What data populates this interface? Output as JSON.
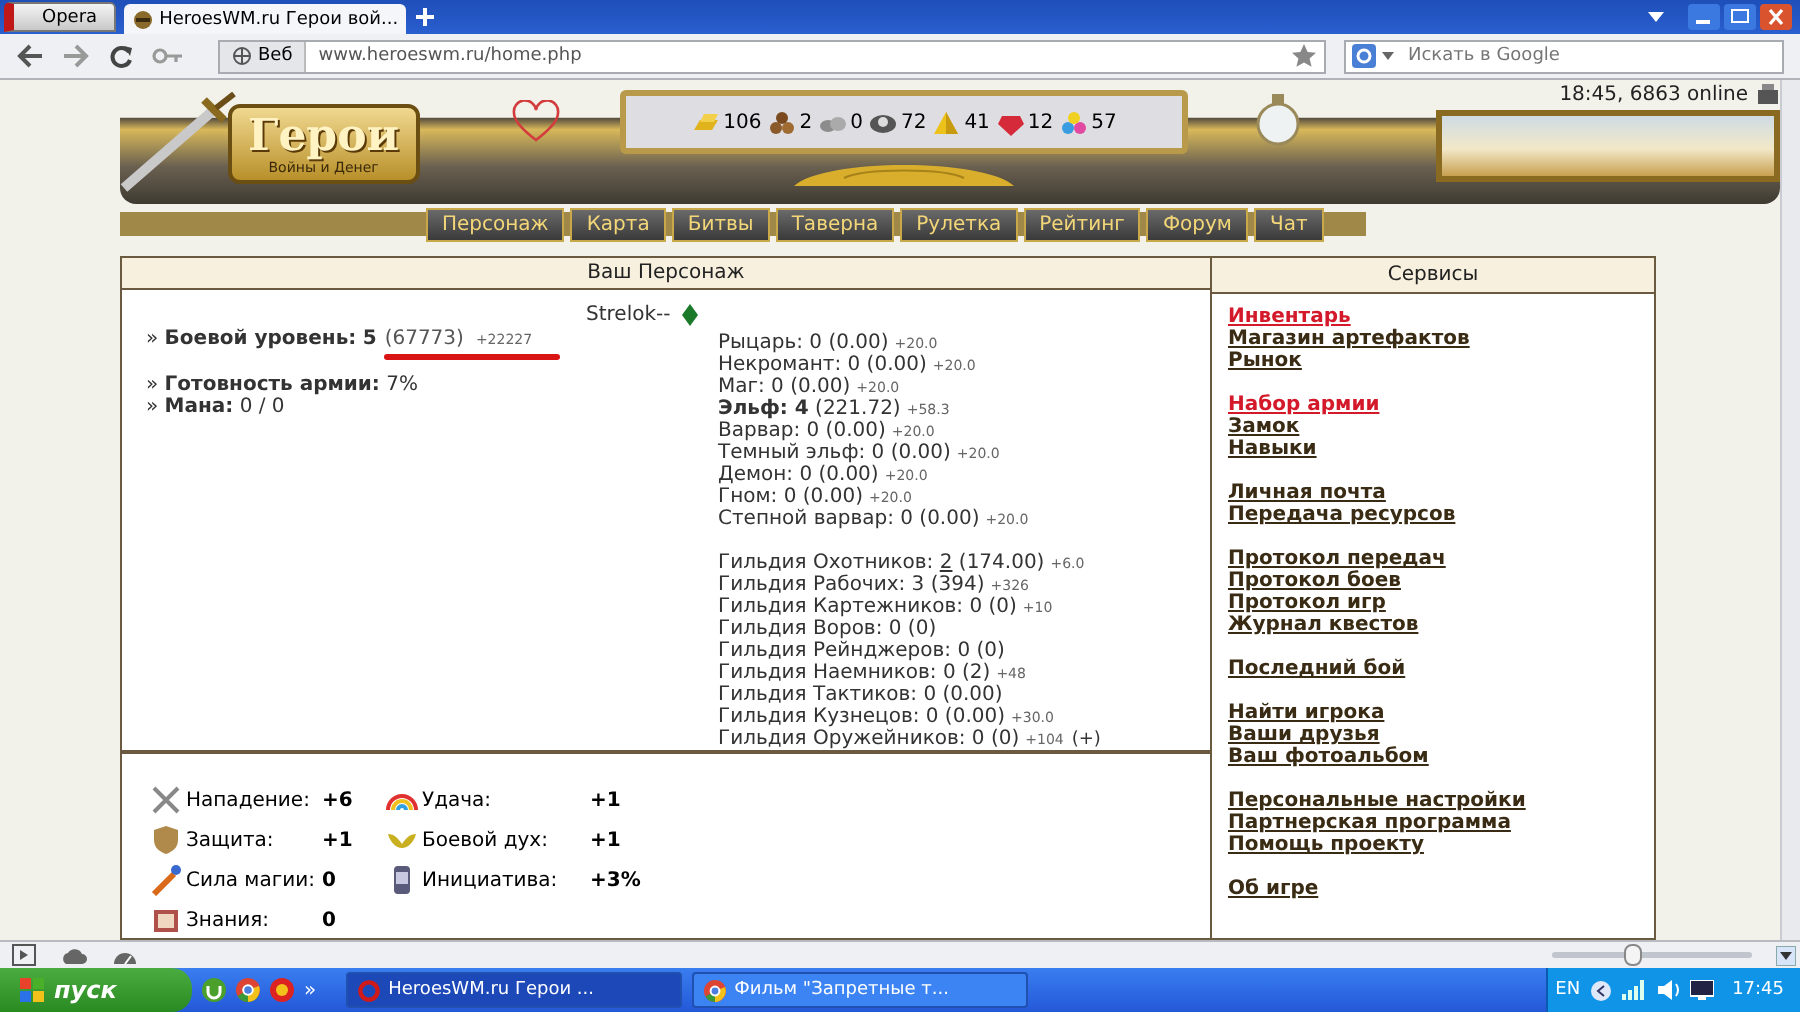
{
  "browser": {
    "menu_button": "Opera",
    "tabs": [
      {
        "title": "HeroesWM.ru Герои вой...",
        "selected": true
      }
    ],
    "address": {
      "badge": "Веб",
      "url": "www.heroeswm.ru/home.php"
    },
    "search": {
      "placeholder": "Искать в Google"
    }
  },
  "header": {
    "logo": {
      "title": "Герои",
      "subtitle": "Войны и Денег"
    },
    "resources": [
      {
        "kind": "gold",
        "value": "106"
      },
      {
        "kind": "wood",
        "value": "2"
      },
      {
        "kind": "ore",
        "value": "0"
      },
      {
        "kind": "mercury",
        "value": "72"
      },
      {
        "kind": "sulfur",
        "value": "41"
      },
      {
        "kind": "crystal",
        "value": "12"
      },
      {
        "kind": "gems",
        "value": "57"
      }
    ],
    "online": "18:45, 6863 online",
    "nav": [
      "Персонаж",
      "Карта",
      "Битвы",
      "Таверна",
      "Рулетка",
      "Рейтинг",
      "Форум",
      "Чат"
    ]
  },
  "character": {
    "title": "Ваш Персонаж",
    "name": "Strelok--",
    "stats": [
      {
        "bullet": "»",
        "label": "Боевой уровень:",
        "value": "5",
        "points": "(67773)",
        "bonus": "+22227",
        "highlighted": true
      },
      {
        "bullet": "»",
        "label": "Готовность армии:",
        "value": "7%",
        "highlighted": false
      },
      {
        "bullet": "»",
        "label": "Мана:",
        "value": "0 / 0",
        "highlighted": false
      }
    ],
    "factions": [
      {
        "label": "Рыцарь:",
        "level": "0",
        "points": "(0.00)",
        "bonus": "+20.0",
        "bold": false
      },
      {
        "label": "Некромант:",
        "level": "0",
        "points": "(0.00)",
        "bonus": "+20.0",
        "bold": false
      },
      {
        "label": "Маг:",
        "level": "0",
        "points": "(0.00)",
        "bonus": "+20.0",
        "bold": false
      },
      {
        "label": "Эльф:",
        "level": "4",
        "points": "(221.72)",
        "bonus": "+58.3",
        "bold": true
      },
      {
        "label": "Варвар:",
        "level": "0",
        "points": "(0.00)",
        "bonus": "+20.0",
        "bold": false
      },
      {
        "label": "Темный эльф:",
        "level": "0",
        "points": "(0.00)",
        "bonus": "+20.0",
        "bold": false
      },
      {
        "label": "Демон:",
        "level": "0",
        "points": "(0.00)",
        "bonus": "+20.0",
        "bold": false
      },
      {
        "label": "Гном:",
        "level": "0",
        "points": "(0.00)",
        "bonus": "+20.0",
        "bold": false
      },
      {
        "label": "Степной варвар:",
        "level": "0",
        "points": "(0.00)",
        "bonus": "+20.0",
        "bold": false
      }
    ],
    "guilds": [
      {
        "label": "Гильдия Охотников:",
        "level": "2",
        "points": "(174.00)",
        "bonus": "+6.0",
        "level_link": true
      },
      {
        "label": "Гильдия Рабочих:",
        "level": "3",
        "points": "(394)",
        "bonus": "+326",
        "level_link": false
      },
      {
        "label": "Гильдия Картежников:",
        "level": "0",
        "points": "(0)",
        "bonus": "+10",
        "level_link": false
      },
      {
        "label": "Гильдия Воров:",
        "level": "0",
        "points": "(0)",
        "level_link": false
      },
      {
        "label": "Гильдия Рейнджеров:",
        "level": "0",
        "points": "(0)",
        "level_link": false
      },
      {
        "label": "Гильдия Наемников:",
        "level": "0",
        "points": "(2)",
        "bonus": "+48",
        "level_link": false
      },
      {
        "label": "Гильдия Тактиков:",
        "level": "0",
        "points": "(0.00)",
        "level_link": false
      },
      {
        "label": "Гильдия Кузнецов:",
        "level": "0",
        "points": "(0.00)",
        "bonus": "+30.0",
        "level_link": false
      },
      {
        "label": "Гильдия Оружейников:",
        "level": "0",
        "points": "(0)",
        "bonus": "+104",
        "action": "(+)",
        "level_link": false
      }
    ],
    "skills": [
      [
        {
          "kind": "attack",
          "label": "Нападение:",
          "value": "+6"
        },
        {
          "kind": "defense",
          "label": "Защита:",
          "value": "+1"
        },
        {
          "kind": "spellpower",
          "label": "Сила магии:",
          "value": "0"
        },
        {
          "kind": "knowledge",
          "label": "Знания:",
          "value": "0"
        }
      ],
      [
        {
          "kind": "luck",
          "label": "Удача:",
          "value": "+1"
        },
        {
          "kind": "morale",
          "label": "Боевой дух:",
          "value": "+1"
        },
        {
          "kind": "initiative",
          "label": "Инициатива:",
          "value": "+3%"
        }
      ]
    ]
  },
  "services": {
    "title": "Сервисы",
    "groups": [
      [
        {
          "label": "Инвентарь",
          "highlighted": true
        },
        {
          "label": "Магазин артефактов",
          "highlighted": false
        },
        {
          "label": "Рынок",
          "highlighted": false
        }
      ],
      [
        {
          "label": "Набор армии",
          "highlighted": true
        },
        {
          "label": "Замок",
          "highlighted": false
        },
        {
          "label": "Навыки",
          "highlighted": false
        }
      ],
      [
        {
          "label": "Личная почта",
          "highlighted": false
        },
        {
          "label": "Передача ресурсов",
          "highlighted": false
        }
      ],
      [
        {
          "label": "Протокол передач",
          "highlighted": false
        },
        {
          "label": "Протокол боев",
          "highlighted": false
        },
        {
          "label": "Протокол игр",
          "highlighted": false
        },
        {
          "label": "Журнал квестов",
          "highlighted": false
        }
      ],
      [
        {
          "label": "Последний бой",
          "highlighted": false
        }
      ],
      [
        {
          "label": "Найти игрока",
          "highlighted": false
        },
        {
          "label": "Ваши друзья",
          "highlighted": false
        },
        {
          "label": "Ваш фотоальбом",
          "highlighted": false
        }
      ],
      [
        {
          "label": "Персональные настройки",
          "highlighted": false
        },
        {
          "label": "Партнерская программа",
          "highlighted": false
        },
        {
          "label": "Помощь проекту",
          "highlighted": false
        }
      ],
      [
        {
          "label": "Об игре",
          "highlighted": false
        }
      ]
    ]
  },
  "status_bar": {
    "zoom": {
      "level": 0.4
    }
  },
  "taskbar": {
    "start": "пуск",
    "more": "»",
    "tasks": [
      {
        "title": "HeroesWM.ru Герои ...",
        "kind": "opera",
        "selected": true
      },
      {
        "title": "Фильм \"Запретные т...",
        "kind": "chrome",
        "selected": false
      }
    ],
    "language": "EN",
    "clock": "17:45"
  }
}
